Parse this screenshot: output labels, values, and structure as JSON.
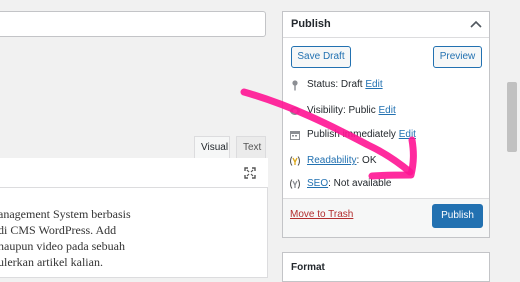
{
  "editor": {
    "tab_visual": "Visual",
    "tab_text": "Text",
    "lines": [
      "anagement System berbasis",
      "di CMS WordPress. Add",
      "naupun video pada sebuah",
      "ulerkan artikel kalian."
    ]
  },
  "publish": {
    "title": "Publish",
    "save_draft": "Save Draft",
    "preview": "Preview",
    "status_label": "Status: Draft",
    "status_edit": "Edit",
    "visibility_label": "Visibility: Public",
    "visibility_edit": "Edit",
    "publish_label": "Publish immediately",
    "publish_edit": "Edit",
    "readability_label": "Readability",
    "readability_value": ": OK",
    "seo_label": "SEO",
    "seo_value": ": Not available",
    "trash": "Move to Trash",
    "publish_button": "Publish"
  },
  "format": {
    "title": "Format"
  },
  "icons": {
    "status": "pin-icon",
    "visibility": "eye-icon",
    "schedule": "calendar-icon",
    "readability": "yoast-icon",
    "seo": "yoast-icon",
    "collapse": "chevron-up-icon",
    "fullscreen": "fullscreen-icon"
  },
  "colors": {
    "accent": "#2271b1",
    "trash": "#b32d2e",
    "annotation": "#ff1493"
  }
}
